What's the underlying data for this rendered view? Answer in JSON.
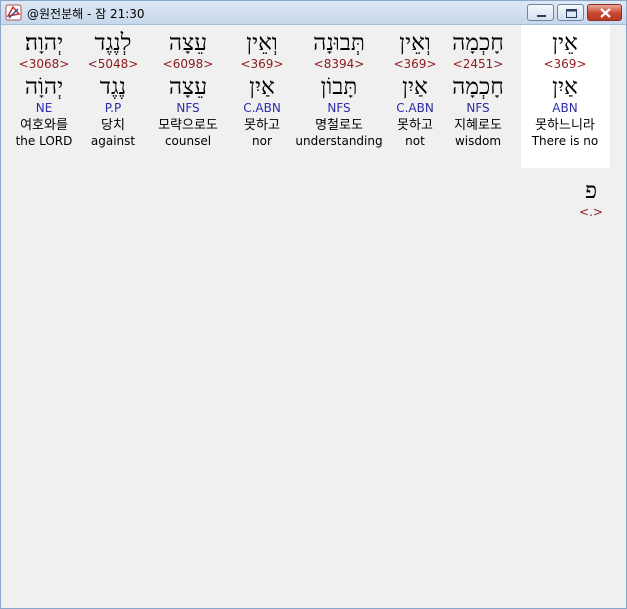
{
  "window": {
    "title": "@원전분해 - 잠 21:30",
    "colors": {
      "title_bar": "#c7d7ec",
      "close_button": "#c8462d",
      "strong_number": "#8b1a1a",
      "parse_code": "#2c2ca8"
    },
    "buttons": {
      "minimize": "minimize-icon",
      "maximize": "maximize-icon",
      "close": "close-icon"
    }
  },
  "words": [
    {
      "hebrew": "אֵין",
      "strong": "<369>",
      "lemma": "אַיִן",
      "parse": "ABN",
      "korean": "못하느니라",
      "english": "There is no",
      "selected": true
    },
    {
      "hebrew": "חָכְמָה",
      "strong": "<2451>",
      "lemma": "חָכְמָה",
      "parse": "NFS",
      "korean": "지혜로도",
      "english": "wisdom",
      "selected": false
    },
    {
      "hebrew": "וְאֵין",
      "strong": "<369>",
      "lemma": "אַיִן",
      "parse": "C.ABN",
      "korean": "못하고",
      "english": "not",
      "selected": false
    },
    {
      "hebrew": "תְּבוּנָה",
      "strong": "<8394>",
      "lemma": "תָּבוֹן",
      "parse": "NFS",
      "korean": "명철로도",
      "english": "understanding",
      "selected": false
    },
    {
      "hebrew": "וְאֵין",
      "strong": "<369>",
      "lemma": "אַיִן",
      "parse": "C.ABN",
      "korean": "못하고",
      "english": "nor",
      "selected": false
    },
    {
      "hebrew": "עֵצָה",
      "strong": "<6098>",
      "lemma": "עֵצָה",
      "parse": "NFS",
      "korean": "모략으로도",
      "english": "counsel",
      "selected": false
    },
    {
      "hebrew": "לְנֶגֶד",
      "strong": "<5048>",
      "lemma": "נֶגֶד",
      "parse": "P.P",
      "korean": "당치",
      "english": "against",
      "selected": false
    },
    {
      "hebrew": "יְהוָה׃",
      "strong": "<3068>",
      "lemma": "יְהוָֹה",
      "parse": "NE",
      "korean": "여호와를",
      "english": "the LORD",
      "selected": false
    }
  ],
  "extra": {
    "hebrew": "פ",
    "strong": "<.>"
  }
}
